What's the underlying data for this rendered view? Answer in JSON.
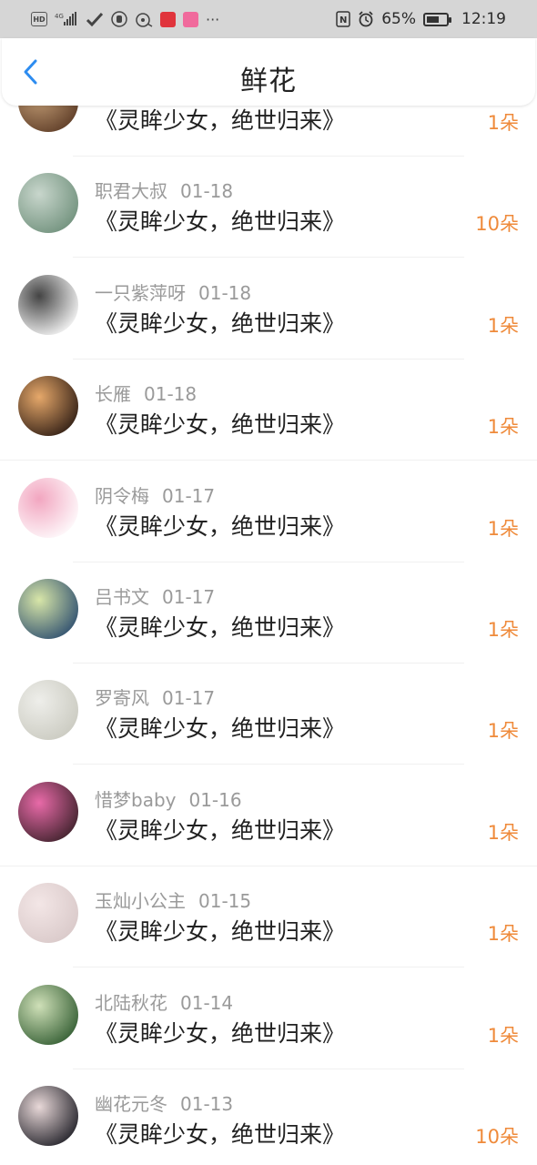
{
  "status_bar": {
    "left_icons": [
      "hd-icon",
      "signal-4g-icon",
      "check-icon",
      "hand-icon",
      "wifi-icon",
      "app-red-icon",
      "app-pink-icon",
      "more-icon"
    ],
    "hd": "HD",
    "net": "4G",
    "more": "···",
    "nfc": "N",
    "battery_percent": "65%",
    "battery_level": 0.65,
    "time": "12:19"
  },
  "header": {
    "title": "鲜花"
  },
  "rows": [
    {
      "name": "",
      "date": "",
      "book": "《灵眸少女，绝世归来》",
      "count": "1朵",
      "avatar_colors": [
        "#5b3a25",
        "#c9a37a"
      ]
    },
    {
      "name": "职君大叔",
      "date": "01-18",
      "book": "《灵眸少女，绝世归来》",
      "count": "10朵",
      "avatar_colors": [
        "#6e8f7a",
        "#c8d6cc"
      ]
    },
    {
      "name": "一只紫萍呀",
      "date": "01-18",
      "book": "《灵眸少女，绝世归来》",
      "count": "1朵",
      "avatar_colors": [
        "#ffffff",
        "#444444"
      ]
    },
    {
      "name": "长雁",
      "date": "01-18",
      "book": "《灵眸少女，绝世归来》",
      "count": "1朵",
      "avatar_colors": [
        "#2b1a12",
        "#e6a86a"
      ]
    },
    {
      "name": "阴令梅",
      "date": "01-17",
      "book": "《灵眸少女，绝世归来》",
      "count": "1朵",
      "avatar_colors": [
        "#ffffff",
        "#f2a6c0"
      ]
    },
    {
      "name": "吕书文",
      "date": "01-17",
      "book": "《灵眸少女，绝世归来》",
      "count": "1朵",
      "avatar_colors": [
        "#2a4b6e",
        "#d8e6a8"
      ]
    },
    {
      "name": "罗寄风",
      "date": "01-17",
      "book": "《灵眸少女，绝世归来》",
      "count": "1朵",
      "avatar_colors": [
        "#c9c9bf",
        "#eeeeea"
      ]
    },
    {
      "name": "惜梦baby",
      "date": "01-16",
      "book": "《灵眸少女，绝世归来》",
      "count": "1朵",
      "avatar_colors": [
        "#3a2028",
        "#e86aa8"
      ]
    },
    {
      "name": "玉灿小公主",
      "date": "01-15",
      "book": "《灵眸少女，绝世归来》",
      "count": "1朵",
      "avatar_colors": [
        "#d8c8c8",
        "#f3e6e6"
      ]
    },
    {
      "name": "北陆秋花",
      "date": "01-14",
      "book": "《灵眸少女，绝世归来》",
      "count": "1朵",
      "avatar_colors": [
        "#2f5a2f",
        "#cfe0b8"
      ]
    },
    {
      "name": "幽花元冬",
      "date": "01-13",
      "book": "《灵眸少女，绝世归来》",
      "count": "10朵",
      "avatar_colors": [
        "#1c1c24",
        "#e8d8d8"
      ]
    }
  ],
  "accent_color": "#ef8a3a",
  "back_color": "#2d8cf0"
}
